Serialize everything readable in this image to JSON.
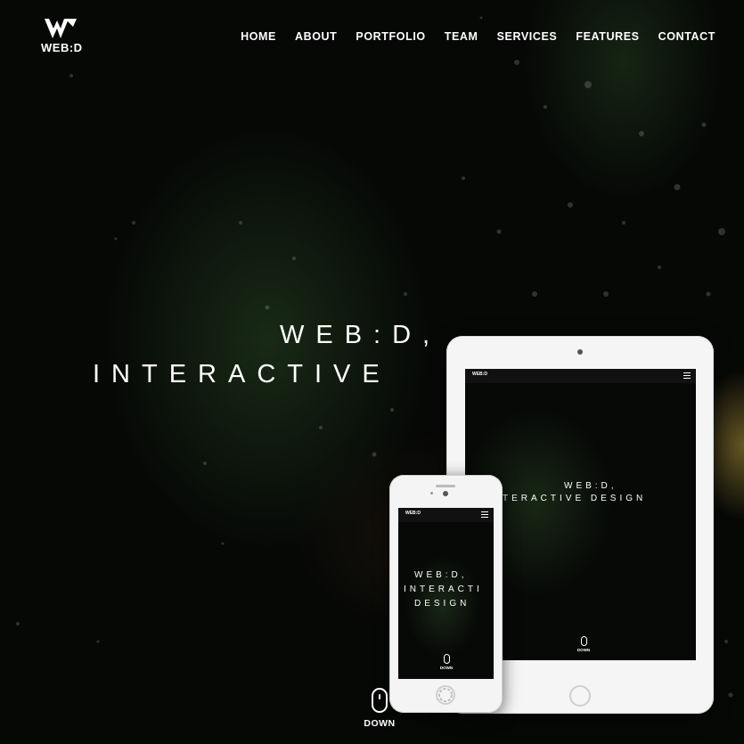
{
  "brand": {
    "name": "WEB:D"
  },
  "nav": {
    "items": [
      "HOME",
      "ABOUT",
      "PORTFOLIO",
      "TEAM",
      "SERVICES",
      "FEATURES",
      "CONTACT"
    ]
  },
  "hero": {
    "line1": "WEB:D,",
    "line2": "INTERACTIVE",
    "down_label": "DOWN"
  },
  "tablet_screen": {
    "logo": "WEB:D",
    "line1": "WEB:D,",
    "line2": "TERACTIVE DESIGN",
    "down_label": "DOWN"
  },
  "phone_screen": {
    "logo": "WEB:D",
    "line1": "WEB:D,",
    "line2": "INTERACTI",
    "line3": "DESIGN",
    "down_label": "DOWN"
  },
  "colors": {
    "background": "#050505",
    "text": "#ffffff",
    "device_frame": "#f5f5f5"
  },
  "icons": [
    "logo-w-icon",
    "scroll-mouse-icon",
    "hamburger-menu-icon",
    "loading-spinner-icon"
  ]
}
